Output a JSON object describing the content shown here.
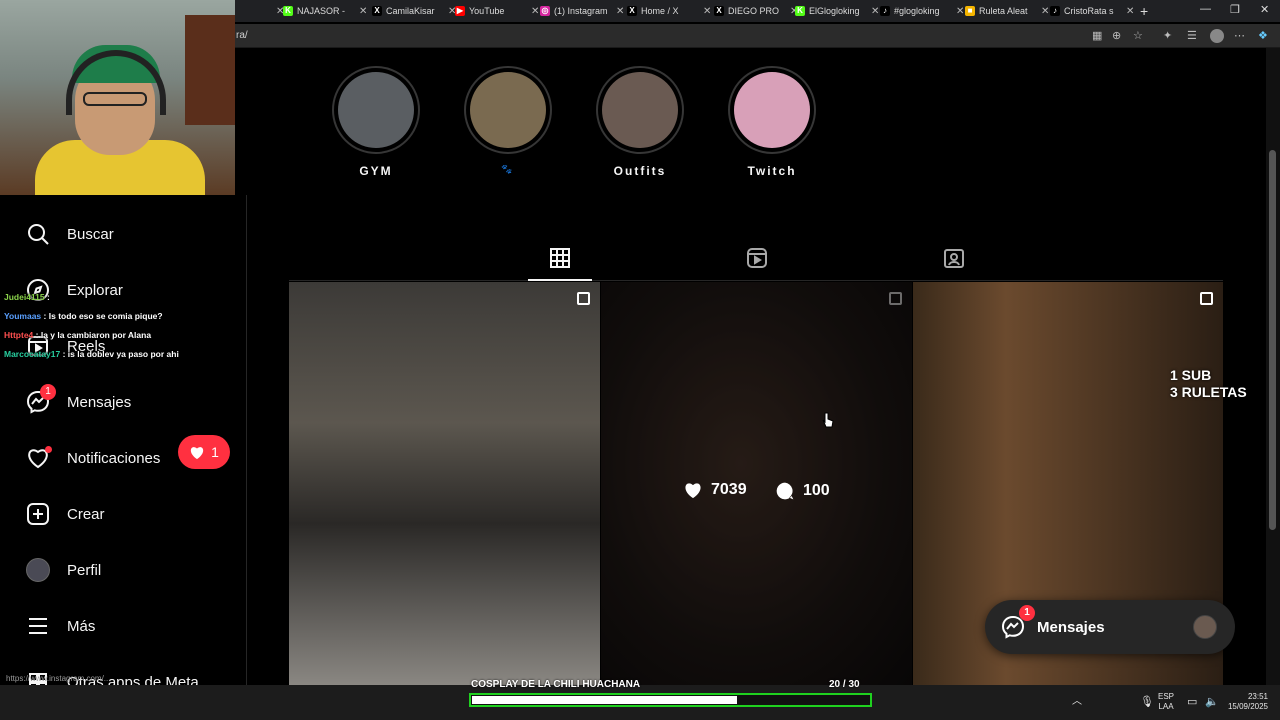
{
  "browser": {
    "tabs": [
      {
        "title": "NAJASOR -",
        "favicon_color": "#53fc18",
        "favicon_glyph": "K"
      },
      {
        "title": "CamilaKisar",
        "favicon_color": "#000000",
        "favicon_glyph": "X"
      },
      {
        "title": "YouTube",
        "favicon_color": "#ff0000",
        "favicon_glyph": "▶"
      },
      {
        "title": "(1) Instagram",
        "favicon_color": "#d6249f",
        "favicon_glyph": "◎"
      },
      {
        "title": "Home / X",
        "favicon_color": "#000000",
        "favicon_glyph": "X"
      },
      {
        "title": "DIEGO PRO",
        "favicon_color": "#000000",
        "favicon_glyph": "X"
      },
      {
        "title": "ElGlogloking",
        "favicon_color": "#53fc18",
        "favicon_glyph": "K"
      },
      {
        "title": "#glogloking",
        "favicon_color": "#000000",
        "favicon_glyph": "♪"
      },
      {
        "title": "Ruleta Aleat",
        "favicon_color": "#f4b400",
        "favicon_glyph": "■"
      },
      {
        "title": "CristoRata s",
        "favicon_color": "#000000",
        "favicon_glyph": "♪"
      }
    ],
    "new_tab": "+",
    "address": "ra/"
  },
  "nav": {
    "items": [
      {
        "label": "Buscar",
        "icon": "search-icon"
      },
      {
        "label": "Explorar",
        "icon": "compass-icon"
      },
      {
        "label": "Reels",
        "icon": "reels-icon"
      },
      {
        "label": "Mensajes",
        "icon": "messenger-icon",
        "badge": "1"
      },
      {
        "label": "Notificaciones",
        "icon": "heart-icon"
      },
      {
        "label": "Crear",
        "icon": "plus-square-icon"
      },
      {
        "label": "Perfil",
        "icon": "avatar"
      },
      {
        "label": "Más",
        "icon": "menu-icon"
      },
      {
        "label": "Otras apps de Meta",
        "icon": "apps-icon"
      }
    ],
    "notif_popup_count": "1"
  },
  "chat": [
    {
      "user": "Judei4115",
      "text": ":"
    },
    {
      "user": "Youmaas",
      "text": ": Is todo eso se comia pique?"
    },
    {
      "user": "Httpte4",
      "text": ": la y la cambiaron por Alana"
    },
    {
      "user": "Marcocatay17",
      "text": ": is la doblev ya paso por ahi"
    }
  ],
  "highlights": [
    {
      "label": "GYM",
      "color": "#5a5e62"
    },
    {
      "label": "🐾",
      "color": "#7a6a50"
    },
    {
      "label": "Outfits",
      "color": "#6a5a52"
    },
    {
      "label": "Twitch",
      "color": "#d8a0b8"
    }
  ],
  "profile_tabs": [
    "grid-icon",
    "reels-tab-icon",
    "tagged-icon"
  ],
  "posts": [
    {
      "type": "carousel"
    },
    {
      "type": "carousel",
      "likes": "7039",
      "comments": "100",
      "hovered": true
    },
    {
      "type": "carousel"
    }
  ],
  "overlay_text": {
    "line1": "1 SUB",
    "line2": "3 RULETAS"
  },
  "messages_pill": {
    "label": "Mensajes",
    "badge": "1"
  },
  "goal": {
    "title": "COSPLAY DE LA CHILI HUACHANA",
    "count": "20  / 30",
    "progress": 0.667
  },
  "status_url": "https://www.instagram.com/...",
  "taskbar": {
    "lang_line1": "ESP",
    "lang_line2": "LAA",
    "time": "23:51",
    "date": "15/09/2025"
  }
}
